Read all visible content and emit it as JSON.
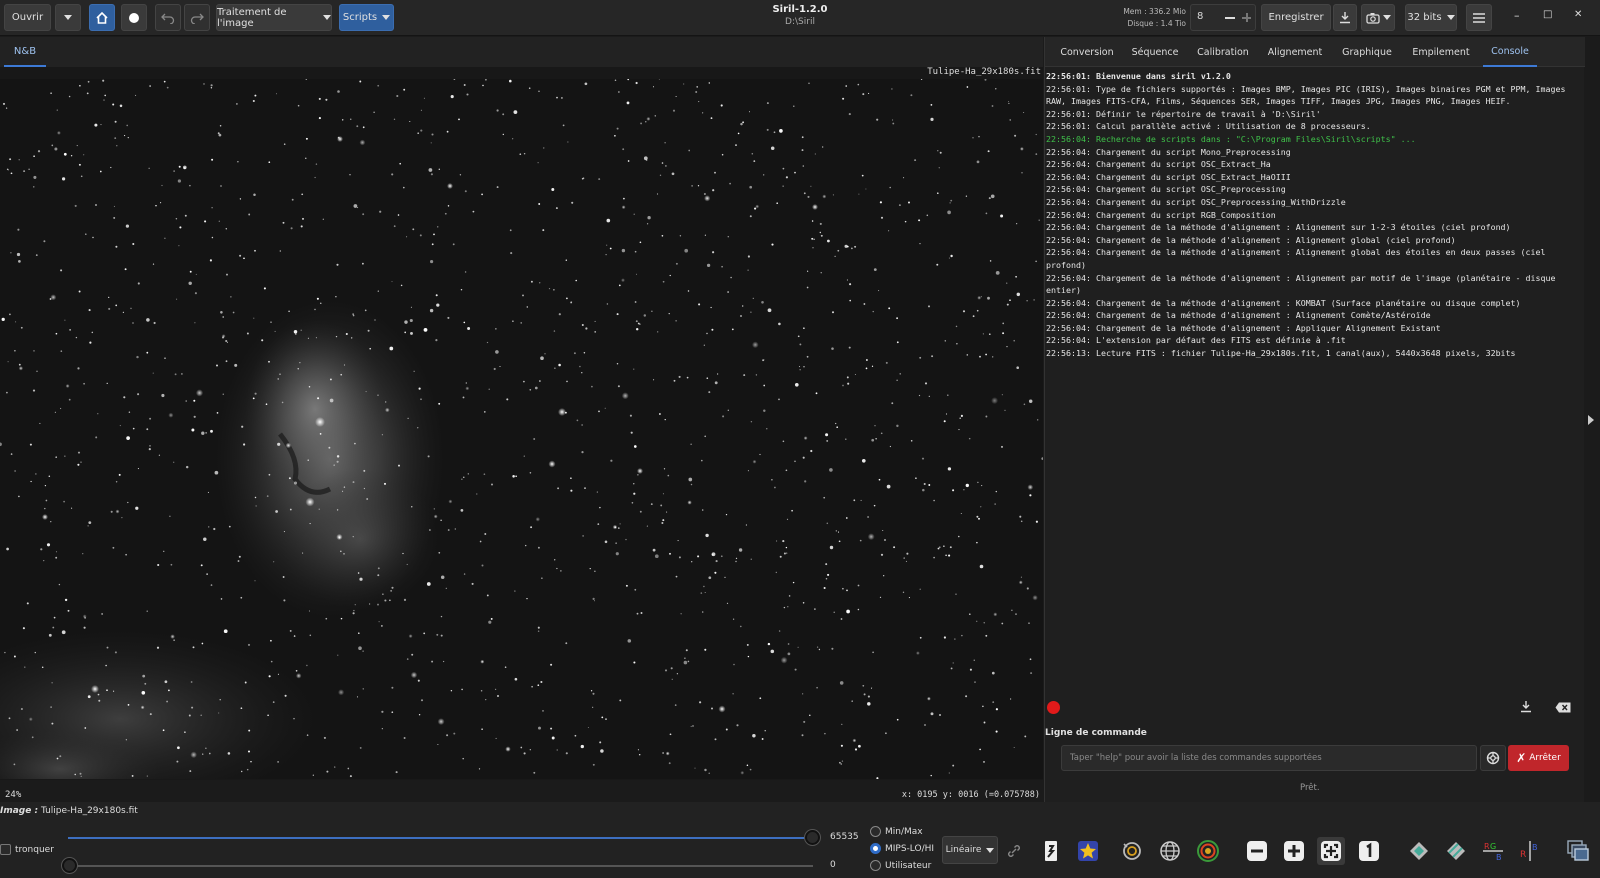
{
  "header": {
    "open_label": "Ouvrir",
    "image_processing_label": "Traitement de l'image",
    "scripts_label": "Scripts",
    "app_title": "Siril-1.2.0",
    "working_dir": "D:\\Siril",
    "mem_info": "Mem : 336.2 Mio",
    "disk_info": "Disque : 1.4 Tio",
    "threads_value": "8",
    "save_label": "Enregistrer",
    "bitdepth_label": "32 bits",
    "minimize": "–",
    "maximize": "□",
    "close": "✕"
  },
  "left_tabs": {
    "nb_label": "N&B"
  },
  "image": {
    "filename": "Tulipe-Ha_29x180s.fit",
    "zoom": "24%",
    "coords": "x: 0195 y: 0016 (=0.075788)"
  },
  "right_tabs": [
    "Conversion",
    "Séquence",
    "Calibration",
    "Alignement",
    "Graphique",
    "Empilement",
    "Console"
  ],
  "console_lines": [
    {
      "text": "22:56:01: Bienvenue dans siril v1.2.0",
      "style": "bold"
    },
    {
      "text": "22:56:01: Type de fichiers supportés : Images BMP, Images PIC (IRIS), Images binaires PGM et PPM, Images RAW, Images FITS-CFA, Films, Séquences SER, Images TIFF, Images JPG, Images PNG, Images HEIF.",
      "style": ""
    },
    {
      "text": "22:56:01: Définir le répertoire de travail à 'D:\\Siril'",
      "style": ""
    },
    {
      "text": "22:56:01: Calcul parallèle activé : Utilisation de 8 processeurs.",
      "style": ""
    },
    {
      "text": "22:56:04: Recherche de scripts dans : \"C:\\Program Files\\Siril\\scripts\" ...",
      "style": "green"
    },
    {
      "text": "22:56:04: Chargement du script Mono_Preprocessing",
      "style": ""
    },
    {
      "text": "22:56:04: Chargement du script OSC_Extract_Ha",
      "style": ""
    },
    {
      "text": "22:56:04: Chargement du script OSC_Extract_HaOIII",
      "style": ""
    },
    {
      "text": "22:56:04: Chargement du script OSC_Preprocessing",
      "style": ""
    },
    {
      "text": "22:56:04: Chargement du script OSC_Preprocessing_WithDrizzle",
      "style": ""
    },
    {
      "text": "22:56:04: Chargement du script RGB_Composition",
      "style": ""
    },
    {
      "text": "22:56:04: Chargement de la méthode d'alignement : Alignement sur 1-2-3 étoiles (ciel profond)",
      "style": ""
    },
    {
      "text": "22:56:04: Chargement de la méthode d'alignement : Alignement global (ciel profond)",
      "style": ""
    },
    {
      "text": "22:56:04: Chargement de la méthode d'alignement : Alignement global des étoiles en deux passes (ciel profond)",
      "style": ""
    },
    {
      "text": "22:56:04: Chargement de la méthode d'alignement : Alignement par motif de l'image (planétaire - disque entier)",
      "style": ""
    },
    {
      "text": "22:56:04: Chargement de la méthode d'alignement : KOMBAT (Surface planétaire ou disque complet)",
      "style": ""
    },
    {
      "text": "22:56:04: Chargement de la méthode d'alignement : Alignement Comète/Astéroïde",
      "style": ""
    },
    {
      "text": "22:56:04: Chargement de la méthode d'alignement : Appliquer Alignement Existant",
      "style": ""
    },
    {
      "text": "22:56:04: L'extension par défaut des FITS est définie à .fit",
      "style": ""
    },
    {
      "text": "22:56:13: Lecture FITS : fichier Tulipe-Ha_29x180s.fit, 1 canal(aux), 5440x3648 pixels, 32bits",
      "style": ""
    }
  ],
  "command": {
    "label": "Ligne de commande",
    "placeholder": "Taper \"help\" pour avoir la liste des commandes supportées",
    "stop_label": "Arrêter",
    "status": "Prêt."
  },
  "bottom": {
    "image_prefix": "Image :",
    "image_name": "Tulipe-Ha_29x180s.fit",
    "truncate_label": "tronquer",
    "high_value": "65535",
    "low_value": "0",
    "radio_minmax": "Min/Max",
    "radio_mips": "MIPS-LO/HI",
    "radio_user": "Utilisateur",
    "scale_label": "Linéaire"
  },
  "icons": [
    "dropdown-caret-icon",
    "home-icon",
    "record-icon",
    "undo-icon",
    "redo-icon",
    "download-icon",
    "camera-icon",
    "hamburger-menu-icon",
    "save-log-icon",
    "clear-log-icon",
    "help-icon",
    "link-icon",
    "negative-icon",
    "color-star-icon",
    "photometry-icon",
    "globe-icon",
    "target-icon",
    "zoom-out-icon",
    "zoom-in-icon",
    "zoom-fit-icon",
    "zoom-one-icon",
    "flip-icon",
    "mirror-icon",
    "split-rgb-icon",
    "compose-rgb-icon",
    "layers-icon"
  ],
  "colors": {
    "accent": "#3d7ad6",
    "stop": "#c0262b",
    "console_green": "#3fc14a"
  }
}
